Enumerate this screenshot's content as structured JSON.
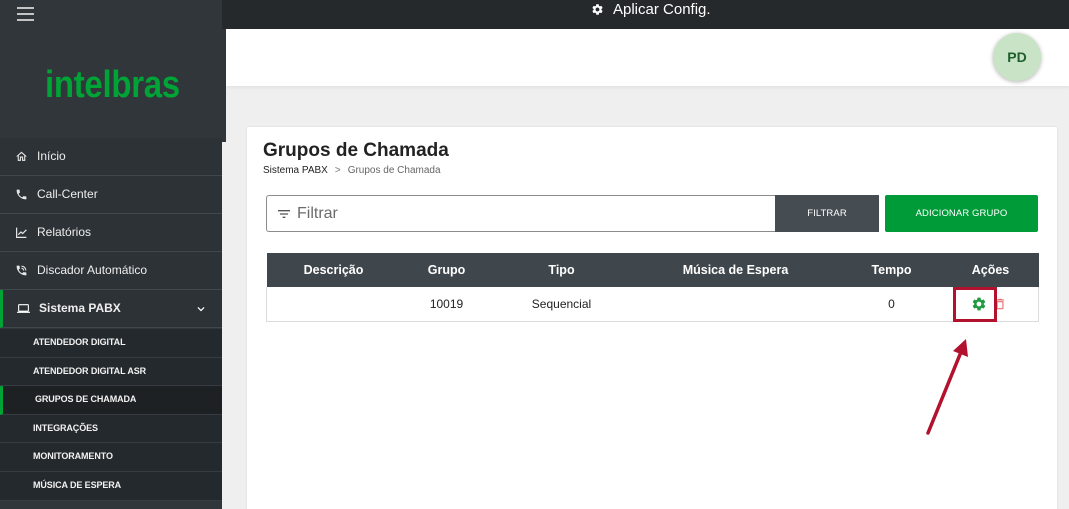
{
  "topbar": {
    "apply_config_label": "Aplicar Config.",
    "apply_config_icon": "gear-icon"
  },
  "sidebar": {
    "menu_icon": "hamburger-icon",
    "logo_text": "intelbras",
    "items": [
      {
        "label": "Início",
        "icon": "home-icon"
      },
      {
        "label": "Call-Center",
        "icon": "phone-icon"
      },
      {
        "label": "Relatórios",
        "icon": "line-chart-icon"
      },
      {
        "label": "Discador Automático",
        "icon": "phone-in-talk-icon"
      },
      {
        "label": "Sistema PABX",
        "icon": "laptop-icon",
        "expanded": true,
        "active": true,
        "expand_icon": "chevron-down-icon"
      }
    ],
    "subitems": [
      {
        "label": "ATENDEDOR DIGITAL",
        "active": false
      },
      {
        "label": "ATENDEDOR DIGITAL ASR",
        "active": false
      },
      {
        "label": "GRUPOS DE CHAMADA",
        "active": true
      },
      {
        "label": "INTEGRAÇÕES",
        "active": false
      },
      {
        "label": "MONITORAMENTO",
        "active": false
      },
      {
        "label": "MÚSICA DE ESPERA",
        "active": false
      }
    ]
  },
  "header": {
    "avatar_initials": "PD"
  },
  "page": {
    "title": "Grupos de Chamada",
    "breadcrumb": {
      "parent": "Sistema PABX",
      "separator": ">",
      "current": "Grupos de Chamada"
    },
    "filter": {
      "icon": "filter-icon",
      "placeholder": "Filtrar",
      "value": "",
      "button_label": "FILTRAR"
    },
    "add_button_label": "ADICIONAR GRUPO"
  },
  "table": {
    "columns": [
      "Descrição",
      "Grupo",
      "Tipo",
      "Música de Espera",
      "Tempo",
      "Ações"
    ],
    "rows": [
      {
        "descricao": "",
        "grupo": "10019",
        "tipo": "Sequencial",
        "musica_de_espera": "",
        "tempo": "0",
        "actions": [
          "gear-icon",
          "trash-icon"
        ]
      }
    ]
  },
  "colors": {
    "brand_green": "#00a335",
    "sidebar_bg": "#30363a",
    "topbar_bg": "#25292c",
    "table_header_bg": "#40474c",
    "filter_button_bg": "#454c52",
    "add_button_bg": "#009b39",
    "edit_icon": "#1e9b3e",
    "delete_icon": "#e57373",
    "annotation_red": "#b2122d",
    "avatar_bg": "#c8e3c6"
  }
}
